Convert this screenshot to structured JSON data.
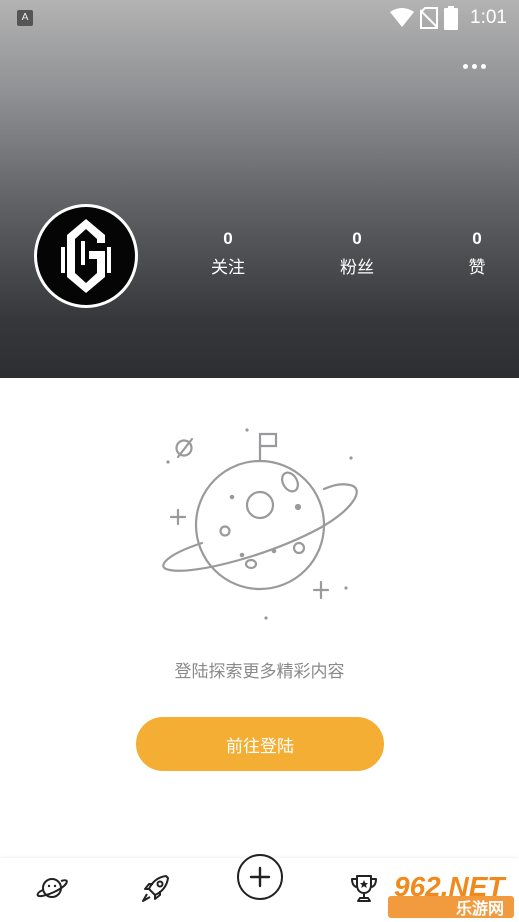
{
  "status_bar": {
    "app_badge": "A",
    "time": "1:01",
    "icons": [
      "wifi-icon",
      "no-sim-icon",
      "battery-icon"
    ]
  },
  "header": {
    "more_icon": "more-dots-icon",
    "avatar_icon": "logo-avatar",
    "stats": [
      {
        "count": "0",
        "label": "关注"
      },
      {
        "count": "0",
        "label": "粉丝"
      },
      {
        "count": "0",
        "label": "赞"
      }
    ]
  },
  "empty_state": {
    "illustration": "planet-illustration",
    "message": "登陆探索更多精彩内容",
    "button_label": "前往登陆"
  },
  "bottom_nav": {
    "items": [
      "planet-icon",
      "rocket-icon",
      "plus-icon",
      "trophy-icon"
    ]
  },
  "watermark": {
    "line1": "962.NET",
    "line2": "乐游网"
  },
  "colors": {
    "accent": "#f3ae33",
    "muted_text": "#8a8a8a",
    "header_top": "#b3b3b3",
    "header_bottom": "#2d2e32"
  }
}
